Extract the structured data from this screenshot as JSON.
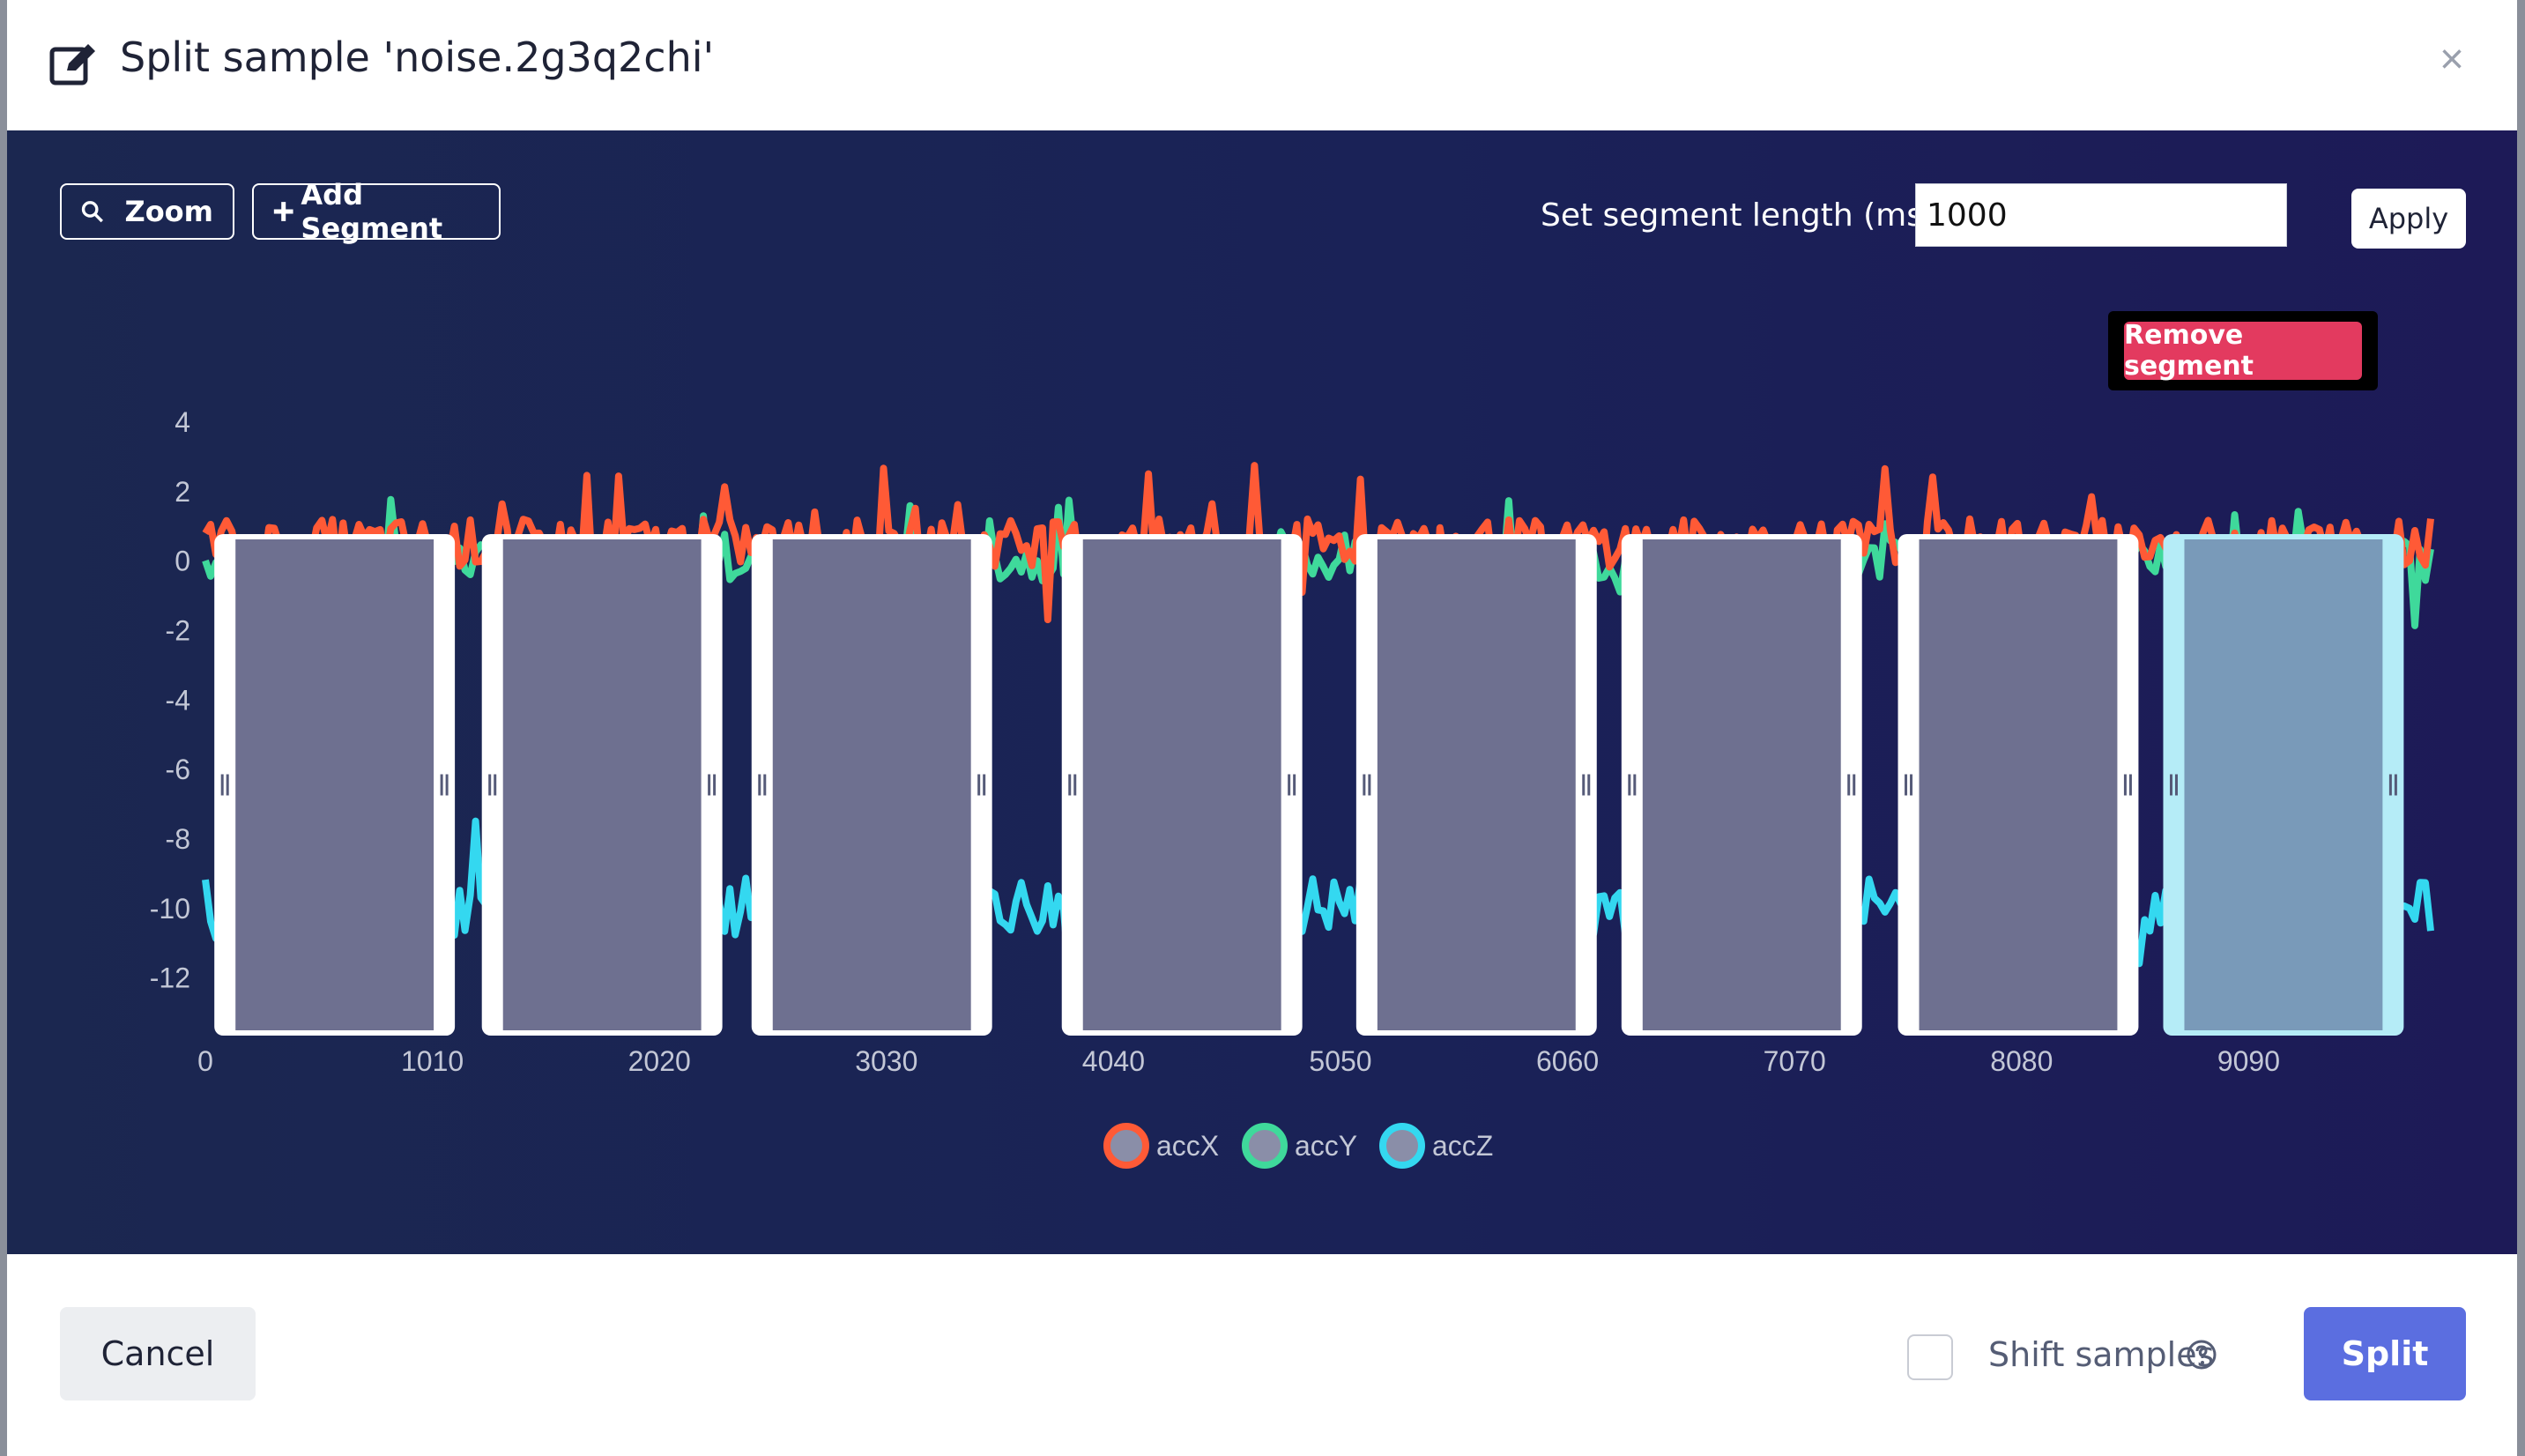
{
  "dialog": {
    "title": "Split sample 'noise.2g3q2chi'",
    "close_glyph": "×",
    "icons": {
      "title": "edit-icon",
      "close": "close-icon"
    }
  },
  "toolbar": {
    "zoom_label": "Zoom",
    "add_segment_label": "Add Segment",
    "segment_length_label": "Set segment length (ms.):",
    "segment_length_value": "1000",
    "apply_label": "Apply",
    "icons": {
      "zoom": "search-icon",
      "add_segment": "plus-icon"
    }
  },
  "tooltip": {
    "remove_segment_label": "Remove segment"
  },
  "footer": {
    "cancel_label": "Cancel",
    "shift_samples_label": "Shift samples",
    "shift_samples_checked": false,
    "split_label": "Split",
    "help_icon": "question-circle-icon"
  },
  "chart_data": {
    "type": "line",
    "title": "",
    "xlabel": "",
    "ylabel": "",
    "x_ticks": [
      "0",
      "1010",
      "2020",
      "3030",
      "4040",
      "5050",
      "6060",
      "7070",
      "8080",
      "9090"
    ],
    "y_ticks": [
      "4",
      "2",
      "0",
      "-2",
      "-4",
      "-6",
      "-8",
      "-10",
      "-12"
    ],
    "xlim": [
      0,
      9900
    ],
    "ylim": [
      -13,
      4
    ],
    "grid": false,
    "legend_position": "bottom",
    "series": [
      {
        "name": "accX",
        "color": "#ff5a36",
        "mean": 0.5,
        "noise": 0.7
      },
      {
        "name": "accY",
        "color": "#3fd99b",
        "mean": 0.0,
        "noise": 0.6
      },
      {
        "name": "accZ",
        "color": "#34d8f0",
        "mean": -10.0,
        "noise": 0.9
      }
    ],
    "segments": [
      {
        "start": 40,
        "end": 1110,
        "selected": false
      },
      {
        "start": 1230,
        "end": 2300,
        "selected": false
      },
      {
        "start": 2430,
        "end": 3500,
        "selected": false
      },
      {
        "start": 3810,
        "end": 4880,
        "selected": false
      },
      {
        "start": 5120,
        "end": 6190,
        "selected": false
      },
      {
        "start": 6300,
        "end": 7370,
        "selected": false
      },
      {
        "start": 7530,
        "end": 8600,
        "selected": false
      },
      {
        "start": 8710,
        "end": 9780,
        "selected": true
      }
    ]
  }
}
